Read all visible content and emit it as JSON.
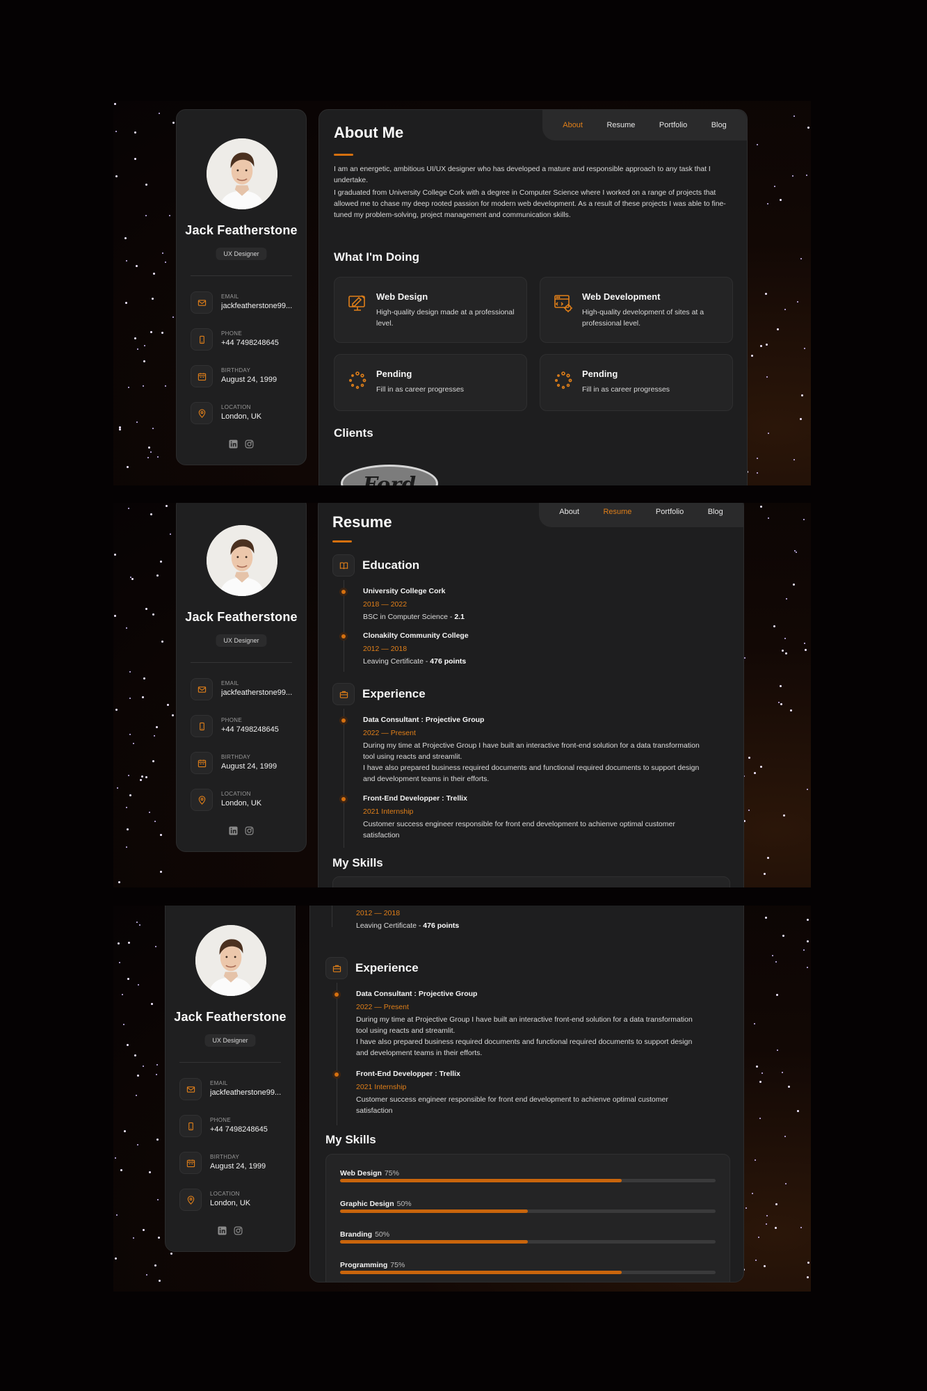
{
  "profile": {
    "name": "Jack Featherstone",
    "title": "UX Designer",
    "contacts": [
      {
        "label": "Email",
        "value": "jackfeatherstone99..."
      },
      {
        "label": "Phone",
        "value": "+44 7498248645"
      },
      {
        "label": "Birthday",
        "value": "August 24, 1999"
      },
      {
        "label": "Location",
        "value": "London, UK"
      }
    ],
    "socials": [
      "linkedin-icon",
      "instagram-icon"
    ]
  },
  "nav": {
    "items": [
      "About",
      "Resume",
      "Portfolio",
      "Blog"
    ]
  },
  "about": {
    "heading": "About Me",
    "paragraphs": [
      "I am an energetic, ambitious UI/UX designer who has developed a mature and responsible approach to any task that I undertake.",
      "I graduated from University College Cork with a degree in Computer Science where I worked on a range of projects that allowed me to chase my deep rooted passion for modern web development. As a result of these projects I was able to fine-tuned my problem-solving, project management and communication skills."
    ],
    "doing_heading": "What I'm Doing",
    "services": [
      {
        "title": "Web Design",
        "desc": "High-quality design made at a professional level.",
        "icon": "design-icon"
      },
      {
        "title": "Web Development",
        "desc": "High-quality development of sites at a professional level.",
        "icon": "dev-icon"
      },
      {
        "title": "Pending",
        "desc": "Fill in as career progresses",
        "icon": "loading-icon"
      },
      {
        "title": "Pending",
        "desc": "Fill in as career progresses",
        "icon": "loading-icon"
      }
    ],
    "clients_heading": "Clients",
    "client_logo_text": "Ford"
  },
  "resume": {
    "heading": "Resume",
    "education_heading": "Education",
    "education": [
      {
        "title": "University College Cork",
        "date": "2018 — 2022",
        "text": "BSC in Computer Science - ",
        "bold": "2.1"
      },
      {
        "title": "Clonakilty Community College",
        "date": "2012 — 2018",
        "text": "Leaving Certificate - ",
        "bold": "476 points"
      }
    ],
    "experience_heading": "Experience",
    "experience": [
      {
        "title": "Data Consultant : Projective Group",
        "date": "2022 — Present",
        "lines": [
          "During my time at Projective Group I have built an interactive front-end solution for a data transformation tool using reacts and streamlit.",
          "I have also prepared business required documents and functional required documents to support design and development teams in their efforts."
        ]
      },
      {
        "title": "Front-End Developper : Trellix",
        "date": "2021 Internship",
        "lines": [
          "Customer success engineer responsible for front end development to achienve optimal customer satisfaction"
        ]
      }
    ],
    "skills_heading": "My Skills",
    "skills": [
      {
        "name": "Web Design",
        "pct_label": "75%",
        "value": 0.75
      },
      {
        "name": "Graphic Design",
        "pct_label": "50%",
        "value": 0.5
      },
      {
        "name": "Branding",
        "pct_label": "50%",
        "value": 0.5
      },
      {
        "name": "Programming",
        "pct_label": "75%",
        "value": 0.75
      }
    ]
  },
  "colors": {
    "accent": "#e07f19",
    "panel": "#1e1e1f",
    "background": "#050203"
  }
}
